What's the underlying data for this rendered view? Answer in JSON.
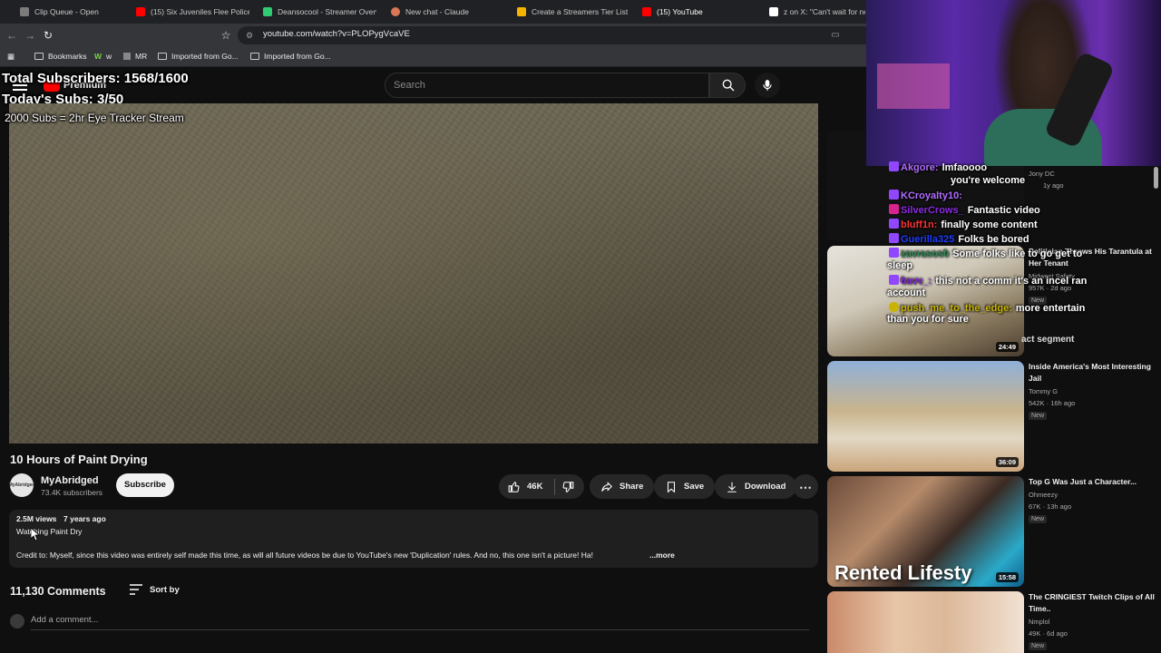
{
  "browser": {
    "tabs": [
      {
        "title": "Clip Queue - Open",
        "color": "#7c7c7c"
      },
      {
        "title": "(15) Six Juveniles Flee Police in",
        "color": "#ff0000"
      },
      {
        "title": "Deansocool - Streamer Overvi",
        "color": "#2ecc71"
      },
      {
        "title": "New chat - Claude",
        "color": "#d97757"
      },
      {
        "title": "Create a Streamers Tier List -",
        "color": "#f4b400"
      },
      {
        "title": "(15) YouTube",
        "color": "#ff0000"
      },
      {
        "title": "z on X: \"Can't wait for nex",
        "color": "#ffffff"
      }
    ],
    "url": "youtube.com/watch?v=PLOPygVcaVE",
    "bookmarks": [
      {
        "label": "Bookmarks"
      },
      {
        "label": "w"
      },
      {
        "label": "MR"
      },
      {
        "label": "Imported from Go..."
      },
      {
        "label": "Imported from Go..."
      }
    ]
  },
  "header": {
    "logo_text": "Premium",
    "search_placeholder": "Search"
  },
  "overlay": {
    "total_subs": "Total Subscribers: 1568/1600",
    "today_subs": "Today's Subs: 3/50",
    "goal": "2000 Subs = 2hr Eye Tracker Stream"
  },
  "video": {
    "title": "10 Hours of Paint Drying",
    "channel": "MyAbridged",
    "avatar_text": "MyAbridged",
    "subscribers": "73.4K subscribers",
    "subscribe_label": "Subscribe",
    "likes": "46K",
    "share_label": "Share",
    "save_label": "Save",
    "download_label": "Download"
  },
  "description": {
    "views": "2.5M views",
    "age": "7 years ago",
    "playlist": "Watching Paint Dry",
    "text": "Credit to: Myself, since this video was entirely self made this time, as will all future videos be due to YouTube's new 'Duplication' rules. And no, this one isn't a picture! Ha!",
    "more": "...more"
  },
  "comments": {
    "count": "11,130 Comments",
    "sort_label": "Sort by",
    "add_placeholder": "Add a comment..."
  },
  "sidebar": {
    "partial_top": {
      "channel": "Jony DC",
      "meta": "1y ago"
    },
    "items": [
      {
        "title": "Politician Throws His Tarantula at Her Tenant",
        "channel": "Midwest Safety",
        "views": "957K",
        "age": "2d ago",
        "new": "New",
        "duration": "24:49"
      },
      {
        "title": "Inside America's Most Interesting Jail",
        "channel": "Tommy G",
        "views": "542K",
        "age": "16h ago",
        "new": "New",
        "duration": "36:09"
      },
      {
        "title": "Top G Was Just a Character...",
        "channel": "Ohmeezy",
        "views": "67K",
        "age": "13h ago",
        "new": "New",
        "duration": "15:58",
        "thumb_text": "Rented Lifesty"
      },
      {
        "title": "The CRINGIEST Twitch Clips of All Time..",
        "channel": "Nmplol",
        "views": "49K",
        "age": "6d ago",
        "new": "New"
      }
    ],
    "segment_label": "act segment"
  },
  "chat": [
    {
      "user": "Akgore:",
      "msg": "lmfaoooo",
      "color": "#b06cff"
    },
    {
      "user": "",
      "msg": "you're welcome",
      "color": "#ffffff"
    },
    {
      "user": "KCroyalty10:",
      "msg": "",
      "color": "#b06cff"
    },
    {
      "user": "SilverCrows_",
      "msg": "Fantastic video",
      "color": "#8a2be2"
    },
    {
      "user": "bluff1n:",
      "msg": "finally some content",
      "color": "#ff3030"
    },
    {
      "user": "Guerilla325",
      "msg": "Folks be bored",
      "color": "#1e3cff"
    },
    {
      "user": "zavrasos0",
      "msg": "Some folks like to go get to",
      "color": "#2e8b57"
    },
    {
      "user": "",
      "msg": "sleep",
      "color": "#ffffff"
    },
    {
      "user": "6avv_:",
      "msg": "this not a comm it's an incel ran",
      "color": "#8a2be2"
    },
    {
      "user": "",
      "msg": "account",
      "color": "#ffffff"
    },
    {
      "user": "push_me_to_the_edge:",
      "msg": "more entertain",
      "color": "#c8b400"
    },
    {
      "user": "",
      "msg": "than you for sure",
      "color": "#ffffff"
    }
  ]
}
